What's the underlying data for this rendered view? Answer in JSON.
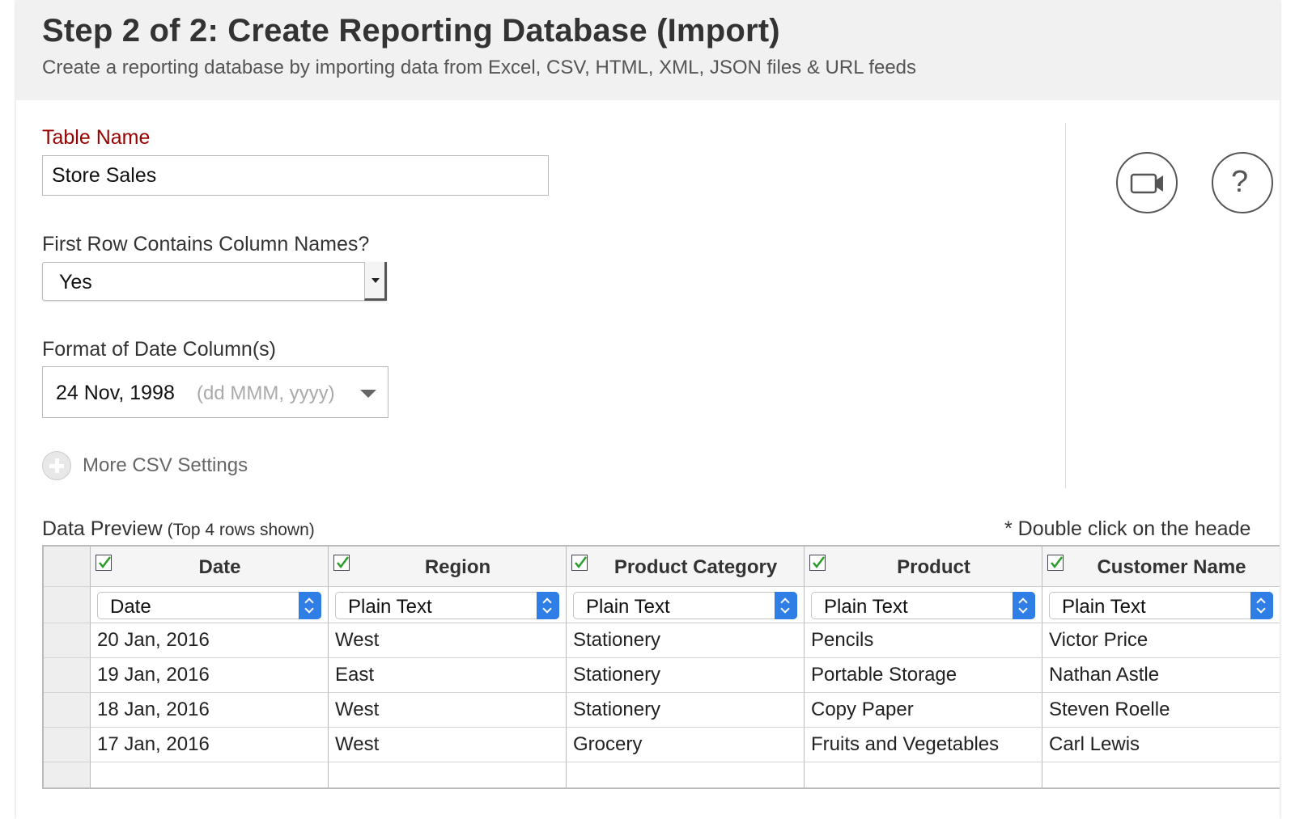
{
  "header": {
    "title": "Step 2 of 2: Create Reporting Database (Import)",
    "subtitle": "Create a reporting database by importing data from Excel, CSV, HTML, XML, JSON files & URL feeds"
  },
  "form": {
    "table_name_label": "Table Name",
    "table_name_value": "Store Sales",
    "first_row_label": "First Row Contains Column Names?",
    "first_row_value": "Yes",
    "date_format_label": "Format of Date Column(s)",
    "date_format_value": "24 Nov, 1998",
    "date_format_hint": "(dd MMM, yyyy)",
    "more_settings_label": "More CSV Settings"
  },
  "side_buttons": {
    "video_icon": "video-camera-icon",
    "help_label": "?"
  },
  "preview": {
    "title": "Data Preview",
    "subtitle": "(Top 4 rows shown)",
    "note": "* Double click on the heade",
    "columns": [
      {
        "name": "Date",
        "type": "Date",
        "checked": true
      },
      {
        "name": "Region",
        "type": "Plain Text",
        "checked": true
      },
      {
        "name": "Product Category",
        "type": "Plain Text",
        "checked": true
      },
      {
        "name": "Product",
        "type": "Plain Text",
        "checked": true
      },
      {
        "name": "Customer Name",
        "type": "Plain Text",
        "checked": true
      }
    ],
    "rows": [
      [
        "20 Jan, 2016",
        "West",
        "Stationery",
        "Pencils",
        "Victor Price"
      ],
      [
        "19 Jan, 2016",
        "East",
        "Stationery",
        "Portable Storage",
        "Nathan Astle"
      ],
      [
        "18 Jan, 2016",
        "West",
        "Stationery",
        "Copy Paper",
        "Steven Roelle"
      ],
      [
        "17 Jan, 2016",
        "West",
        "Grocery",
        "Fruits and Vegetables",
        "Carl Lewis"
      ]
    ]
  },
  "colors": {
    "label_red": "#990000",
    "header_bg": "#f1f1f1",
    "spinner_blue": "#2f7ee6",
    "check_green": "#2a9d2a"
  }
}
